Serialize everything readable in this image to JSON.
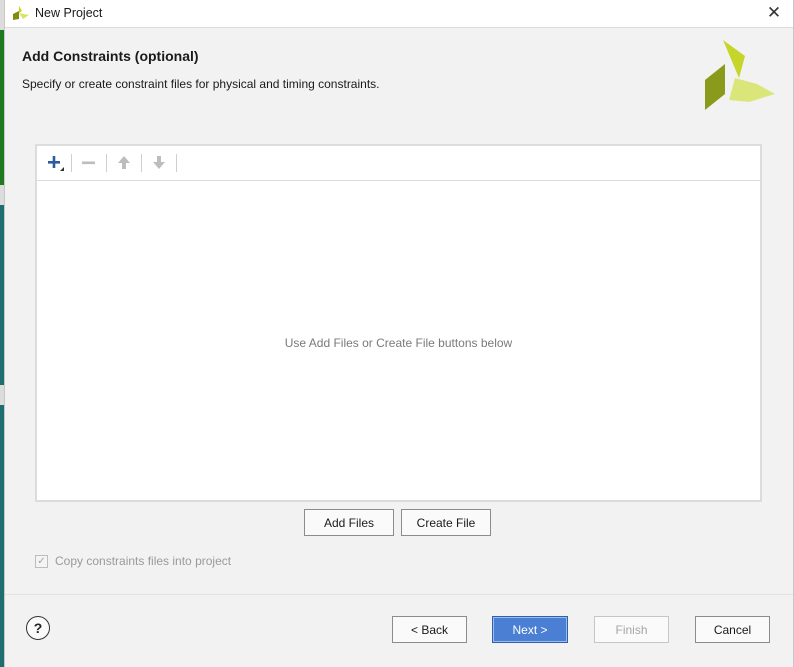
{
  "window": {
    "title": "New Project",
    "close_glyph": "✕"
  },
  "header": {
    "title": "Add Constraints (optional)",
    "subtitle": "Specify or create constraint files for physical and timing constraints."
  },
  "toolbar": {
    "icons": [
      "add-icon",
      "remove-icon",
      "move-up-icon",
      "move-down-icon"
    ]
  },
  "file_list": {
    "empty_message": "Use Add Files or Create File buttons below"
  },
  "actions": {
    "add_files_label": "Add Files",
    "create_file_label": "Create File"
  },
  "options": {
    "copy_label": "Copy constraints files into project",
    "copy_checked": true,
    "check_glyph": "✓"
  },
  "footer": {
    "help_label": "?",
    "back_label": "< Back",
    "next_label": "Next >",
    "finish_label": "Finish",
    "cancel_label": "Cancel"
  },
  "colors": {
    "accent": "#4a7fd4",
    "brand_light": "#d4e157",
    "brand_dark": "#8a9a1a"
  }
}
